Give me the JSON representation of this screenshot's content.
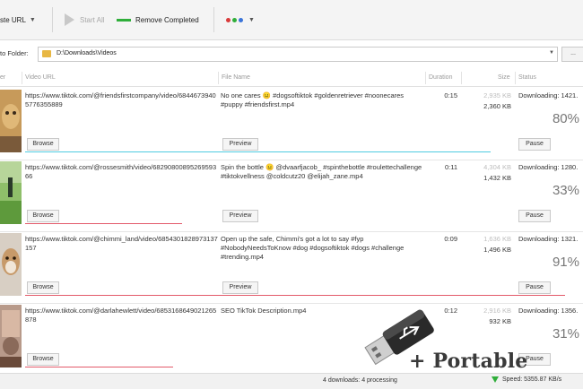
{
  "toolbar": {
    "paste_label": "ste URL",
    "start_all_label": "Start All",
    "remove_completed_label": "Remove Completed",
    "dot_colors": [
      "#d93a3a",
      "#2fae3a",
      "#3a74d9"
    ]
  },
  "folder": {
    "label": "to Folder:",
    "path": "D:\\Downloads\\Videos",
    "browse_label": "..."
  },
  "columns": {
    "thumb": "er",
    "url": "Video URL",
    "file": "File Name",
    "duration": "Duration",
    "size": "Size",
    "status": "Status"
  },
  "rows": [
    {
      "url": "https://www.tiktok.com/@friendsfirstcompany/video/68446739405776355889",
      "file": "No one cares 😐 #dogsoftiktok #goldenretriever #noonecares #puppy #friendsfirst.mp4",
      "duration": "0:15",
      "size_total": "2,935 KB",
      "size_done": "2,360 KB",
      "status": "Downloading: 1421.",
      "percent": "80%",
      "progress": 0.8,
      "progress_color": "#e35a6a",
      "browse": "Browse",
      "preview": "Preview",
      "pause": "Pause"
    },
    {
      "url": "https://www.tiktok.com/@rossesmith/video/6829080089526959366",
      "file": "Spin the bottle 😐 @dvaarfjacob_ #spinthebottle #roulettechallenge #tiktokvellness @coldcutz20 @elijah_zane.mp4",
      "duration": "0:11",
      "size_total": "4,304 KB",
      "size_done": "1,432 KB",
      "status": "Downloading: 1280.",
      "percent": "33%",
      "progress": 0.33,
      "progress_color": "#e35a6a",
      "browse": "Browse",
      "preview": "Preview",
      "pause": "Pause"
    },
    {
      "url": "https://www.tiktok.com/@chimmi_land/video/6854301828973137157",
      "file": "Open up the safe, Chimmi's got a lot to say #fyp #NobodyNeedsToKnow #dog #dogsoftiktok #dogs #challenge #trending.mp4",
      "duration": "0:09",
      "size_total": "1,636 KB",
      "size_done": "1,496 KB",
      "status": "Downloading: 1321.",
      "percent": "91%",
      "progress": 0.91,
      "progress_color": "#e35a6a",
      "browse": "Browse",
      "preview": "Preview",
      "pause": "Pause"
    },
    {
      "url": "https://www.tiktok.com/@darlahewlett/video/6853168649021265878",
      "file": "SEO TikTok Description.mp4",
      "duration": "0:12",
      "size_total": "2,916 KB",
      "size_done": "932 KB",
      "status": "Downloading: 1356.",
      "percent": "31%",
      "progress": 0.31,
      "progress_color": "#e35a6a",
      "browse": "Browse",
      "preview": "",
      "pause": "Pause"
    }
  ],
  "statusbar": {
    "count": "4 downloads: 4 processing",
    "speed": "Speed: 5355.87 KB/s"
  },
  "watermark": {
    "text": "+ Portable",
    "icon": "usb-drive-icon"
  }
}
